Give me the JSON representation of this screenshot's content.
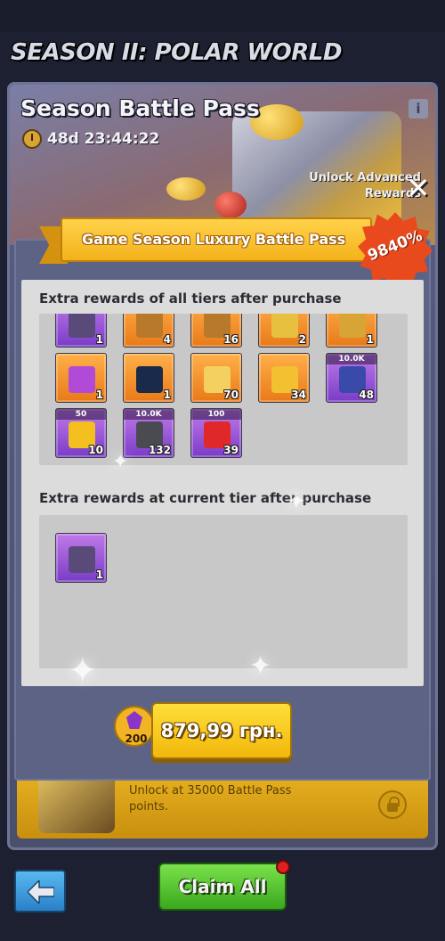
{
  "header": {
    "season_title": "SEASON II: POLAR WORLD"
  },
  "battle_pass": {
    "title": "Season Battle Pass",
    "timer": "48d 23:44:22",
    "info_label": "i",
    "unlock_advanced": "Unlock Advanced Rewards",
    "bottom_row_text": "Unlock at 35000 Battle Pass points."
  },
  "modal": {
    "ribbon_title": "Game Season Luxury Battle Pass",
    "badge": "9840%",
    "close_label": "✕",
    "section_all_tiers": "Extra rewards of all tiers after purchase",
    "section_current_tier": "Extra rewards at current tier after purchase",
    "all_tier_items": [
      {
        "color": "purple",
        "top": "",
        "count": "1",
        "icon": "crate-icon"
      },
      {
        "color": "orange",
        "top": "",
        "count": "4",
        "icon": "chest-icon"
      },
      {
        "color": "orange",
        "top": "",
        "count": "16",
        "icon": "chest-icon"
      },
      {
        "color": "orange",
        "top": "",
        "count": "2",
        "icon": "coupon-icon"
      },
      {
        "color": "orange",
        "top": "",
        "count": "1",
        "icon": "badge-icon"
      },
      {
        "color": "orange",
        "top": "",
        "count": "1",
        "icon": "book-icon"
      },
      {
        "color": "orange",
        "top": "",
        "count": "1",
        "icon": "bar-icon"
      },
      {
        "color": "orange",
        "top": "",
        "count": "70",
        "icon": "ticket-icon"
      },
      {
        "color": "orange",
        "top": "",
        "count": "34",
        "icon": "puzzle-icon"
      },
      {
        "color": "purple",
        "top": "10.0K",
        "count": "48",
        "icon": "exp-book-icon"
      },
      {
        "color": "purple",
        "top": "50",
        "count": "10",
        "icon": "lightning-icon"
      },
      {
        "color": "purple",
        "top": "10.0K",
        "count": "132",
        "icon": "ore-icon"
      },
      {
        "color": "purple",
        "top": "100",
        "count": "39",
        "icon": "ruby-icon"
      }
    ],
    "current_tier_items": [
      {
        "color": "purple",
        "top": "",
        "count": "1",
        "icon": "crate-icon"
      }
    ],
    "gem_count": "200",
    "price": "879,99 грн."
  },
  "footer": {
    "back_label": "back",
    "claim_all": "Claim All"
  },
  "colors": {
    "accent_gold": "#f4b21c",
    "badge_red": "#e84a1e",
    "claim_green": "#3aa81e",
    "back_blue": "#2a80c8"
  }
}
